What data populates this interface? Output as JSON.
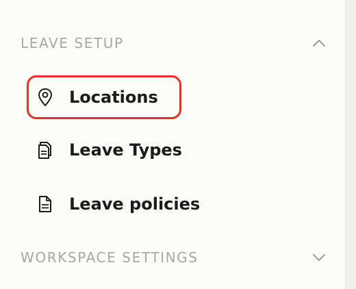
{
  "sidebar": {
    "sections": [
      {
        "title": "LEAVE SETUP",
        "state": "expanded",
        "chevron_icon": "chevron-up-icon",
        "items": [
          {
            "label": "Locations",
            "icon": "location-pin-icon",
            "highlighted": true
          },
          {
            "label": "Leave Types",
            "icon": "documents-icon",
            "highlighted": false
          },
          {
            "label": "Leave policies",
            "icon": "document-icon",
            "highlighted": false
          }
        ]
      },
      {
        "title": "WORKSPACE SETTINGS",
        "state": "collapsed",
        "chevron_icon": "chevron-down-icon",
        "items": []
      }
    ]
  },
  "colors": {
    "background": "#fbfbf8",
    "section_title": "#a7a7a5",
    "item_text": "#1b1b1b",
    "highlight_border": "#e63220"
  }
}
